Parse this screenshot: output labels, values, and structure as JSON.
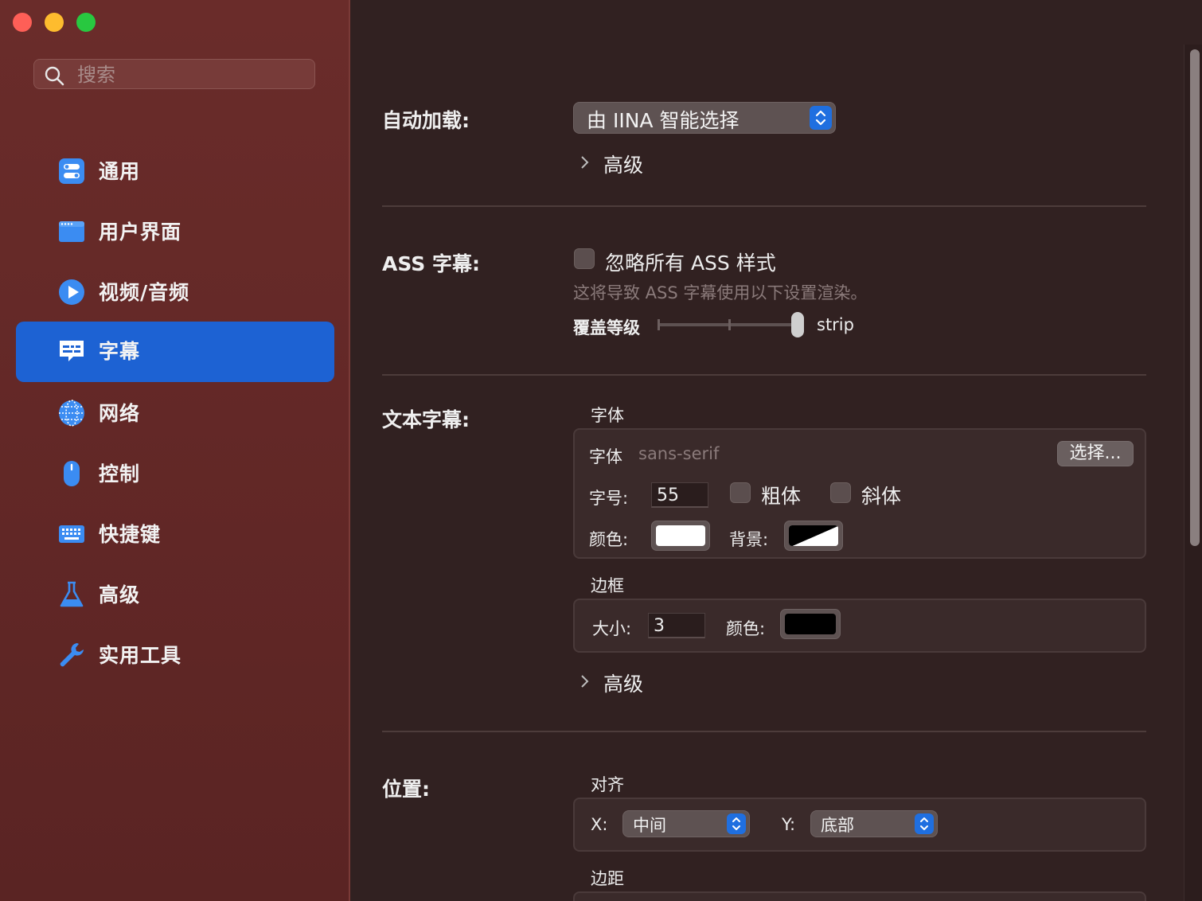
{
  "window": {
    "traffic_lights": {
      "close": "#fe5f57",
      "minimize": "#febc2e",
      "maximize": "#28c840"
    }
  },
  "sidebar": {
    "search": {
      "placeholder": "搜索",
      "icon": "search-icon"
    },
    "accent": "#1d62d3",
    "items": [
      {
        "label": "通用",
        "icon": "toggles-icon",
        "active": false
      },
      {
        "label": "用户界面",
        "icon": "window-icon",
        "active": false
      },
      {
        "label": "视频/音频",
        "icon": "play-icon",
        "active": false
      },
      {
        "label": "字幕",
        "icon": "subtitle-icon",
        "active": true
      },
      {
        "label": "网络",
        "icon": "globe-icon",
        "active": false
      },
      {
        "label": "控制",
        "icon": "mouse-icon",
        "active": false
      },
      {
        "label": "快捷键",
        "icon": "keyboard-icon",
        "active": false
      },
      {
        "label": "高级",
        "icon": "flask-icon",
        "active": false
      },
      {
        "label": "实用工具",
        "icon": "wrench-icon",
        "active": false
      }
    ]
  },
  "content": {
    "auto_load": {
      "title": "自动加载:",
      "popup_value": "由 IINA 智能选择",
      "advanced": "高级"
    },
    "ass": {
      "title": "ASS 字幕:",
      "ignore_styles_label": "忽略所有 ASS 样式",
      "ignore_styles_checked": false,
      "hint": "这将导致 ASS 字幕使用以下设置渲染。",
      "override_label": "覆盖等级",
      "override_value": "strip",
      "override_level_fraction": 1.0
    },
    "text_subs": {
      "title": "文本字幕:",
      "font_heading": "字体",
      "font_label": "字体",
      "font_value": "sans-serif",
      "choose_button": "选择...",
      "size_label": "字号:",
      "size_value": "55",
      "bold_label": "粗体",
      "bold_checked": false,
      "italic_label": "斜体",
      "italic_checked": false,
      "color_label": "颜色:",
      "text_color": "#ffffff",
      "bg_label": "背景:",
      "border_heading": "边框",
      "border_size_label": "大小:",
      "border_size_value": "3",
      "border_color_label": "颜色:",
      "border_color": "#000000",
      "advanced": "高级"
    },
    "position": {
      "title": "位置:",
      "align_heading": "对齐",
      "x_label": "X:",
      "x_value": "中间",
      "y_label": "Y:",
      "y_value": "底部",
      "margin_heading": "边距"
    }
  }
}
